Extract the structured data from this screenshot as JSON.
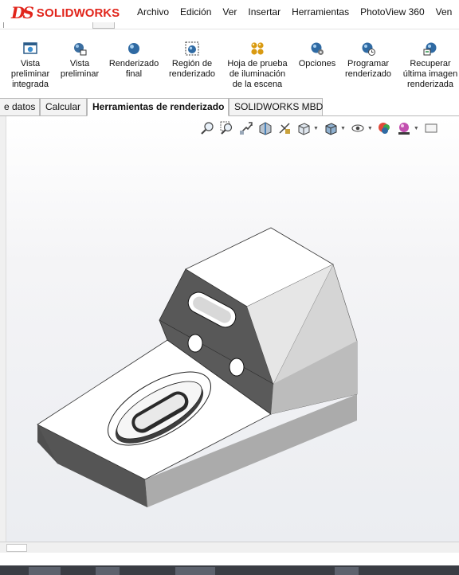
{
  "app": {
    "logo_ds": "DS",
    "logo_solid": "SOLID",
    "logo_works": "WORKS",
    "brand_color": "#e1251b"
  },
  "menu": [
    "Archivo",
    "Edición",
    "Ver",
    "Insertar",
    "Herramientas",
    "PhotoView 360",
    "Ven"
  ],
  "ribbon": {
    "buttons": [
      {
        "label": "Vista\npreliminar\nintegrada",
        "icon": "integrated-preview-icon"
      },
      {
        "label": "Vista\npreliminar",
        "icon": "preview-window-icon"
      },
      {
        "label": "Renderizado\nfinal",
        "icon": "final-render-icon"
      },
      {
        "label": "Región de\nrenderizado",
        "icon": "render-region-icon"
      },
      {
        "label": "Hoja de prueba\nde iluminación\nde la escena",
        "icon": "scene-illumination-proof-icon"
      },
      {
        "label": "Opciones",
        "icon": "options-icon"
      },
      {
        "label": "Programar\nrenderizado",
        "icon": "schedule-render-icon"
      },
      {
        "label": "Recuperar\núltima imagen\nrenderizada",
        "icon": "recover-last-render-icon"
      }
    ]
  },
  "tabs": [
    {
      "label": "e datos",
      "active": false
    },
    {
      "label": "Calcular",
      "active": false
    },
    {
      "label": "Herramientas de renderizado",
      "active": true
    },
    {
      "label": "SOLIDWORKS MBD",
      "active": false
    }
  ],
  "heads_up_toolbar": [
    "zoom-to-fit-icon",
    "zoom-to-area-icon",
    "previous-view-icon",
    "section-view-icon",
    "view-dynamic-annotation-icon",
    "view-orientation-icon",
    "display-style-icon",
    "hide-show-items-icon",
    "edit-appearance-icon",
    "apply-scene-icon",
    "view-settings-icon"
  ]
}
